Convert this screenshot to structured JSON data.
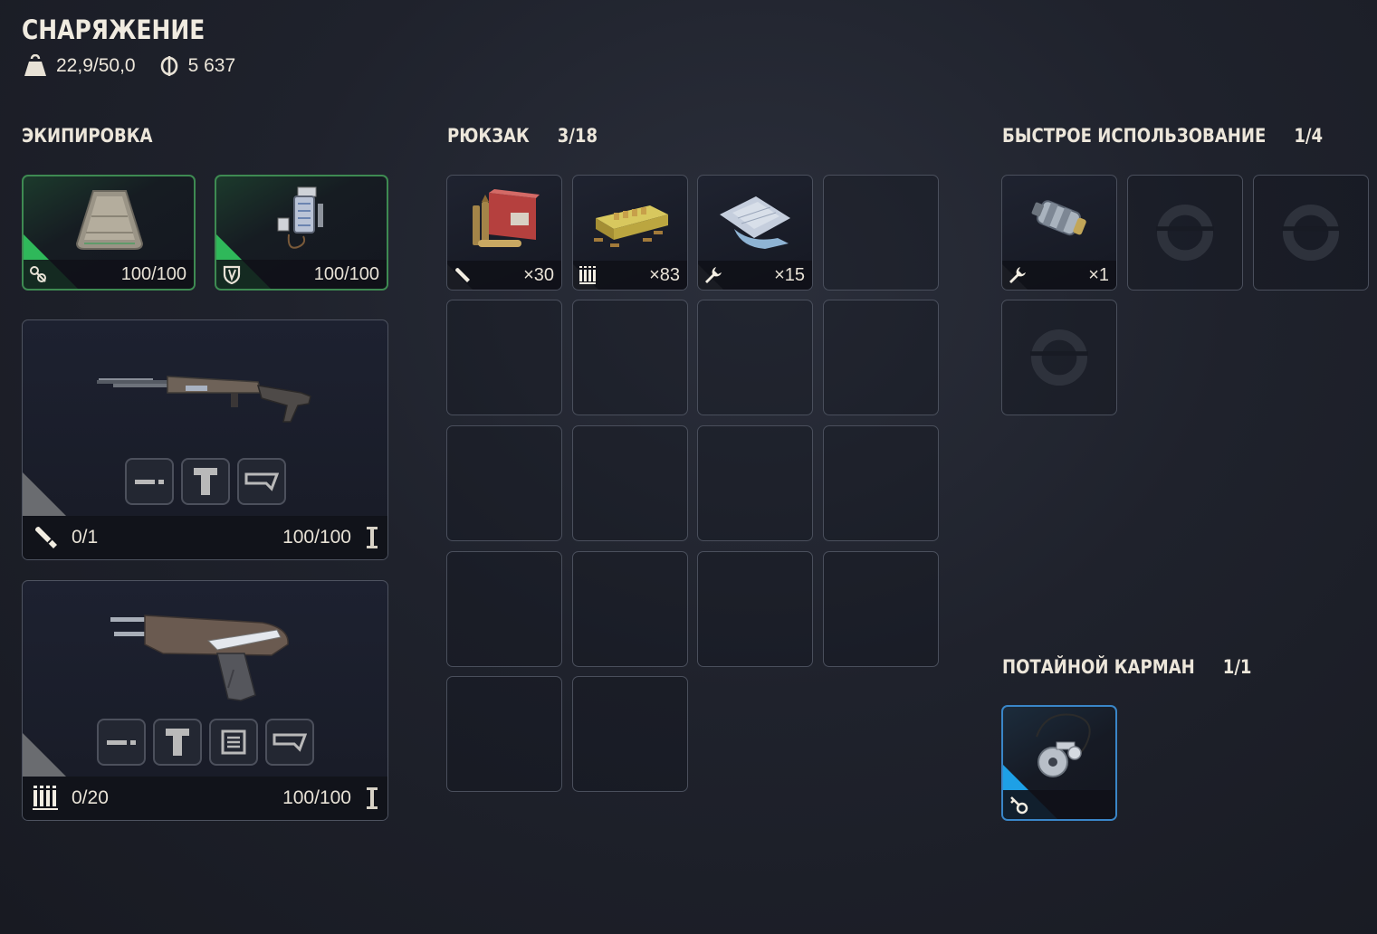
{
  "header": {
    "title": "СНАРЯЖЕНИЕ",
    "weight": "22,9/50,0",
    "weight_icon": "weight-icon",
    "money": "5 637",
    "money_icon": "coin-icon"
  },
  "equipment": {
    "title": "ЭКИПИРОВКА",
    "gear": [
      {
        "icon": "armor-icon",
        "durability": "100/100"
      },
      {
        "icon": "detector-icon",
        "durability": "100/100"
      }
    ],
    "weapons": [
      {
        "name": "rifle",
        "ammo_icon": "rifle-ammo-icon",
        "ammo": "0/1",
        "durability": "100/100",
        "mods": [
          "barrel-mod",
          "scope-mod",
          "stock-mod"
        ]
      },
      {
        "name": "pistol",
        "ammo_icon": "pistol-ammo-icon",
        "ammo": "0/20",
        "durability": "100/100",
        "mods": [
          "barrel-mod",
          "scope-mod",
          "magazine-mod",
          "stock-mod"
        ]
      }
    ]
  },
  "backpack": {
    "title": "РЮКЗАК",
    "count": "3/18",
    "items": [
      {
        "icon": "rifle-ammo-icon",
        "quantity": "×30"
      },
      {
        "icon": "pistol-ammo-icon",
        "quantity": "×83"
      },
      {
        "icon": "wrench-icon",
        "quantity": "×15"
      }
    ]
  },
  "quick_use": {
    "title": "БЫСТРОЕ ИСПОЛЬЗОВАНИЕ",
    "count": "1/4",
    "items": [
      {
        "icon": "wrench-icon",
        "quantity": "×1"
      }
    ]
  },
  "secret_pocket": {
    "title": "ПОТАЙНОЙ КАРМАН",
    "count": "1/1",
    "items": [
      {
        "icon": "key-icon"
      }
    ]
  },
  "colors": {
    "gear_accent": "#2fb85a",
    "pocket_accent": "#1ea0e6"
  }
}
